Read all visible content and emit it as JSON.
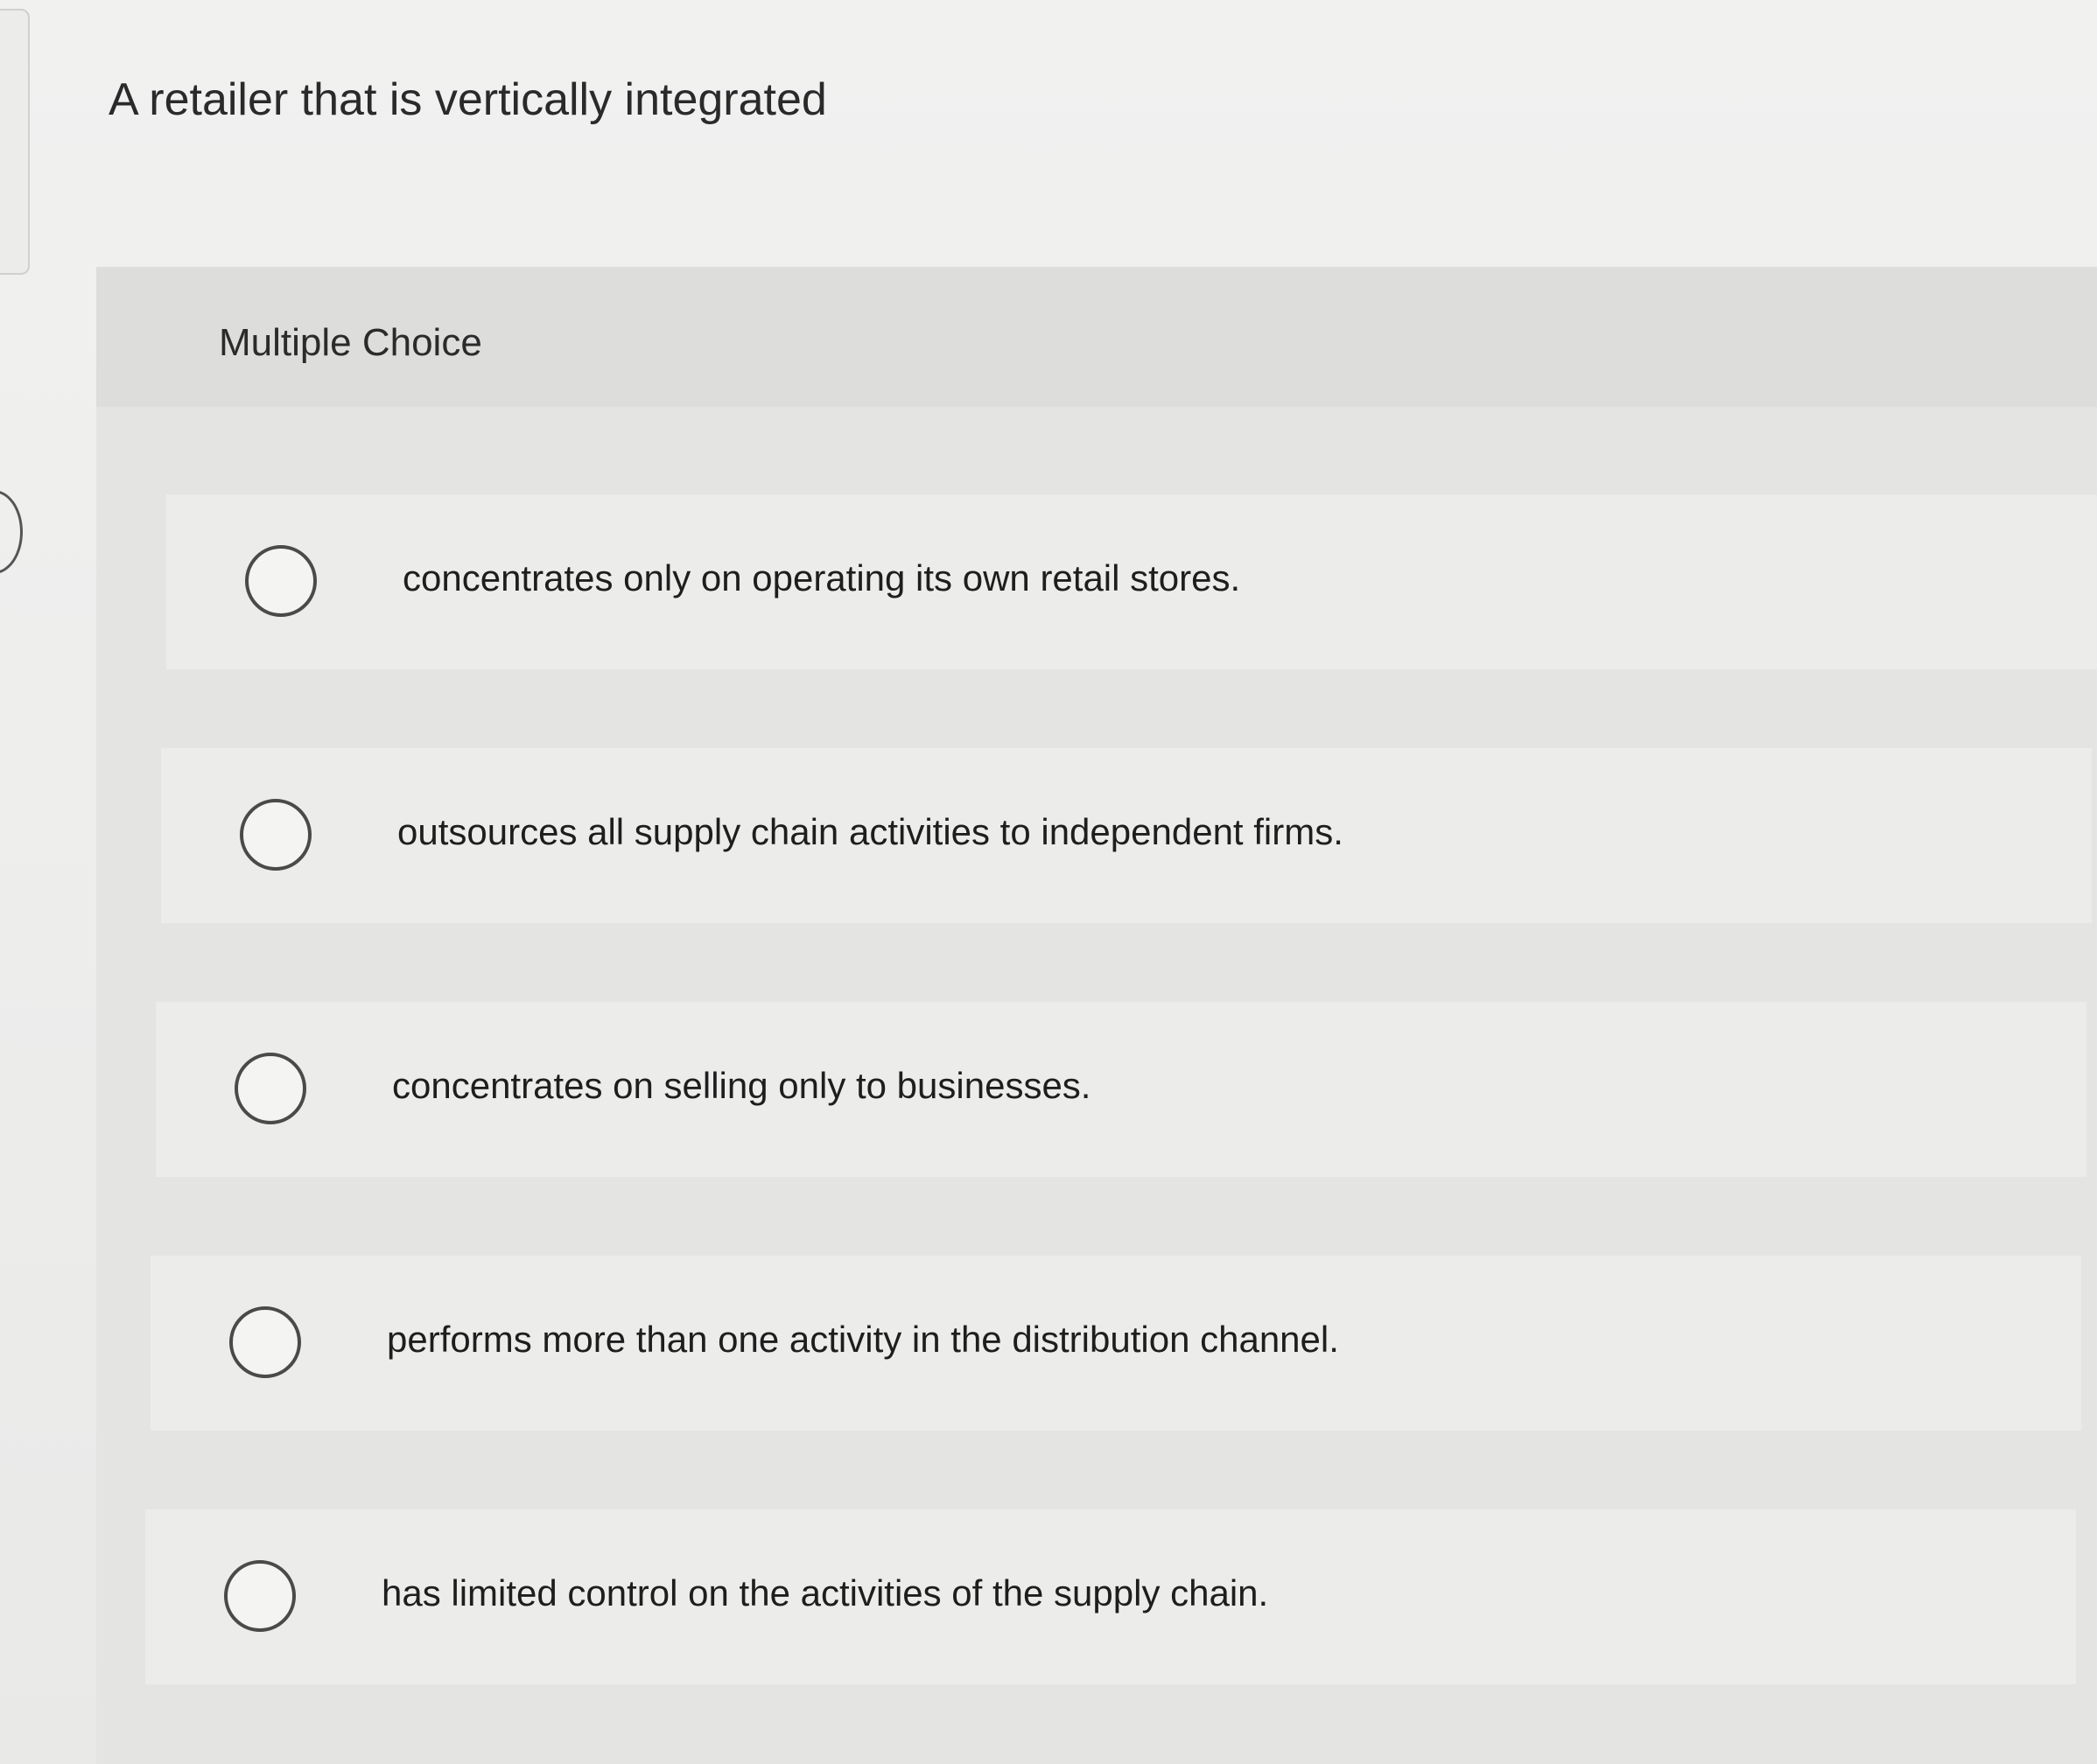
{
  "question": {
    "prompt": "A retailer that is vertically integrated"
  },
  "panel": {
    "type_label": "Multiple Choice"
  },
  "choices": [
    {
      "label": "concentrates only on operating its own retail stores."
    },
    {
      "label": "outsources all supply chain activities to independent firms."
    },
    {
      "label": "concentrates on selling only to businesses."
    },
    {
      "label": "performs more than one activity in the distribution channel."
    },
    {
      "label": "has limited control on the activities of the supply chain."
    }
  ],
  "colors": {
    "page_background": "#efefee",
    "panel_background": "#e4e4e3",
    "row_background": "#ececeb",
    "radio_border": "#4a4a4a",
    "text": "#1e1e1e"
  }
}
